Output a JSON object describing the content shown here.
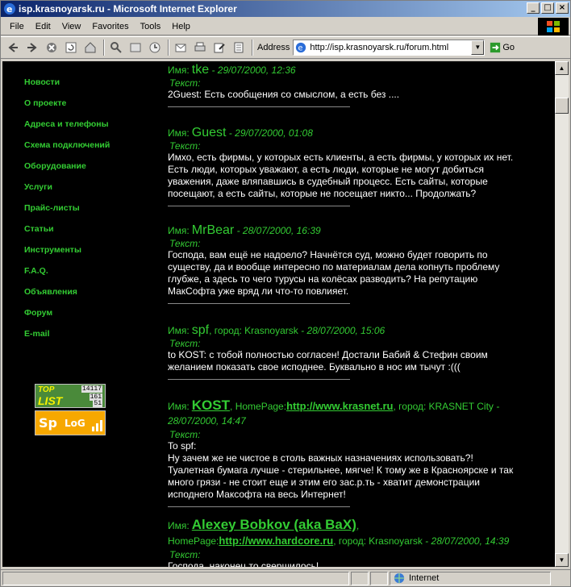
{
  "window": {
    "title": "isp.krasnoyarsk.ru - Microsoft Internet Explorer"
  },
  "menu": [
    "File",
    "Edit",
    "View",
    "Favorites",
    "Tools",
    "Help"
  ],
  "toolbar": {
    "address_label": "Address",
    "url": "http://isp.krasnoyarsk.ru/forum.html",
    "go_label": "Go",
    "icons": [
      "back-icon",
      "forward-icon",
      "stop-icon",
      "refresh-icon",
      "home-icon",
      "search-icon",
      "favorites-icon",
      "history-icon",
      "mail-icon",
      "print-icon",
      "edit-icon",
      "discuss-icon"
    ]
  },
  "nav": [
    "Новости",
    "О проекте",
    "Адреса и телефоны",
    "Схема подключений",
    "Оборудование",
    "Услуги",
    "Прайс-листы",
    "Статьи",
    "Инструменты",
    "F.A.Q.",
    "Объявления",
    "Форум",
    "E-mail"
  ],
  "counters": {
    "top_line1": "TOP",
    "top_line2": "LIST",
    "top_n1": "14117",
    "top_n2": "161",
    "top_n3": "51",
    "splog_1": "Sp",
    "splog_2": "LoG"
  },
  "labels": {
    "name": "Имя:",
    "text": "Текст:",
    "city": "город:",
    "homepage": "HomePage:"
  },
  "posts": [
    {
      "name": "tke",
      "date": "29/07/2000, 12:36",
      "body": "2Guest: Есть сообщения со смыслом, а есть без ...."
    },
    {
      "name": "Guest",
      "date": "29/07/2000, 01:08",
      "body": "Имхо, есть фирмы, у которых есть клиенты, а есть фирмы, у которых их нет. Есть люди, которых уважают, а есть люди, которые не могут добиться уважения, даже вляпавшись в судебный процесс. Есть сайты, которые посещают, а есть сайты, которые не посещает никто... Продолжать?"
    },
    {
      "name": "MrBear",
      "date": "28/07/2000, 16:39",
      "body": "Господа, вам ещё не надоело? Начнётся суд, можно будет говорить по существу, да и вообще интересно по материалам дела копнуть проблему глубже, а здесь то чего турусы на колёсах разводить? На репутацию МакСофта уже вряд ли что-то повлияет."
    },
    {
      "name": "spf",
      "city": "Krasnoyarsk",
      "date": "28/07/2000, 15:06",
      "body": "to KOST: с тобой полностью согласен! Достали Бабий & Стефин своим желанием показать свое исподнее. Буквально в нос им тычут :((("
    },
    {
      "name": "KOST",
      "homepage": "http://www.krasnet.ru",
      "city": "KRASNET City",
      "date": "28/07/2000, 14:47",
      "body1": "To spf:",
      "body2": "Ну зачем же не чистое в столь важных назначениях использовать?! Туалетная бумага лучше - стерильнее, мягче! К тому же в Красноярске и так много грязи - не стоит еще и этим его зас.р.ть - хватит демонстрации исподнего Максофта на весь Интернет!"
    },
    {
      "name": "Alexey Bobkov (aka BaX)",
      "homepage": "http://www.hardcore.ru",
      "city": "Krasnoyarsk",
      "date": "28/07/2000, 14:39",
      "body": "Господа, наконец то свершилось!"
    }
  ],
  "status": {
    "zone": "Internet"
  }
}
